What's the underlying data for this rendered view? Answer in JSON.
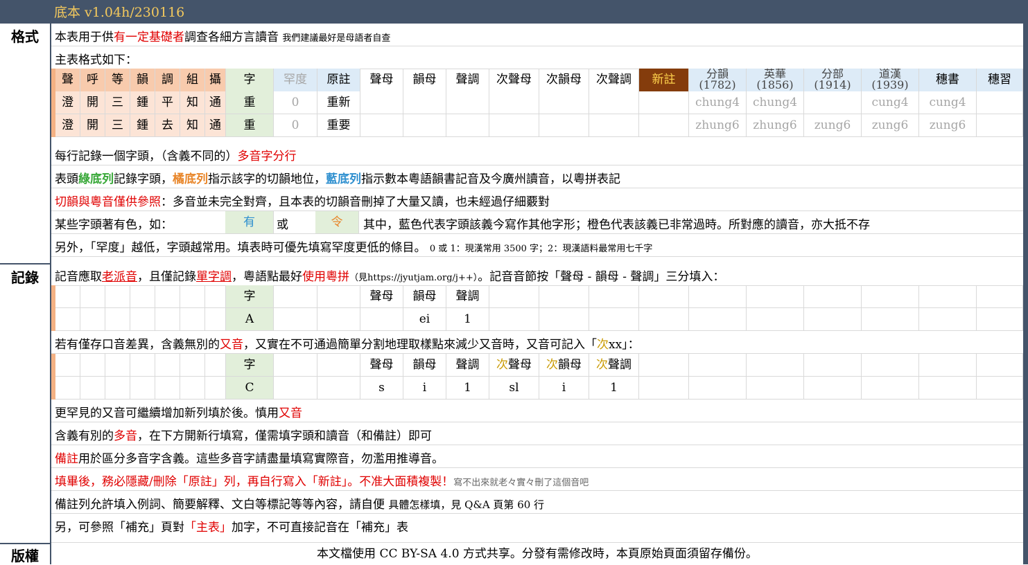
{
  "title": "底本 v1.04h/230116",
  "side_labels": [
    "格式",
    "記錄",
    "版權"
  ],
  "rows": {
    "r1": {
      "a": "本表用于供",
      "b": "有一定基礎者",
      "c": "調查各細方言讀音",
      "d": "我們建議最好是母語者自查"
    },
    "r2": "主表格式如下：",
    "r6": {
      "a": "每行記錄一個字頭，（含義不同的）",
      "b": "多音字分行"
    },
    "r7": {
      "a": "表頭",
      "b": "綠底列",
      "c": "記錄字頭，",
      "d": "橘底列",
      "e": "指示該字的切韻地位，",
      "f": "藍底列",
      "g": "指示數本粵語韻書記音及今廣州讀音，以粵拼表記"
    },
    "r8": {
      "a": "切韻與粵音僅供參照",
      "b": "：多音並未完全對齊，且本表的切韻音刪掉了大量又讀，也未經過仔細覈對"
    },
    "r9": {
      "a": "某些字頭著有色，如：",
      "b": "有",
      "c": "或",
      "d": "令",
      "e": "其中，藍色代表字頭該義今寫作其他字形；橙色代表該義已非常過時。所對應的讀音，亦大抵不存"
    },
    "r10": {
      "a": "另外，「罕度」越低，字頭越常用。填表時可優先填寫罕度更低的條目。",
      "b": "0 或 1：現漢常用 3500 字；2：現漢語料最常用七千字"
    },
    "r11": {
      "a": "記音應取",
      "b": "老派音",
      "c": "，且僅記錄",
      "d": "單字調",
      "e": "，粵語點最好",
      "f": "使用粵拼",
      "g": "（見https://jyutjam.org/j++）",
      "h": "。記音音節按「聲母 - 韻母 - 聲調」三分填入："
    },
    "r14": {
      "a": "若有僅存口音差異，含義無別的",
      "b": "又音",
      "c": "，又實在不可通過簡單分割地理取樣點來減少又音時，又音可記入「",
      "d": "次",
      "e": "xx」："
    },
    "r17": {
      "a": "更罕見的又音可繼續增加新列填於後。慎用",
      "b": "又音"
    },
    "r18": {
      "a": "含義有別的",
      "b": "多音",
      "c": "，在下方開新行填寫，僅需填字頭和讀音（和備註）即可"
    },
    "r19": {
      "a": "備註",
      "b": "用於區分多音字含義。這些多音字請盡量填寫實際音，勿濫用推導音。"
    },
    "r20": {
      "a": "填畢後，務必隱藏/刪除「原註」列，再自行寫入「新註」。不准大面積複製！",
      "b": "寫不出來就老々實々刪了這個音吧"
    },
    "r21": {
      "a": "備註列允許填入例詞、簡要解釋、文白等標記等等內容，請自便",
      "b": "具體怎樣填，見 Q&A 頁第 60 行"
    },
    "r22": {
      "a": "另，可參照「補充」頁對",
      "b": "「主表」",
      "c": "加字，不可直接記音在「補充」表"
    }
  },
  "main_table": {
    "headers": [
      "聲",
      "呼",
      "等",
      "韻",
      "調",
      "組",
      "攝",
      "字",
      "罕度",
      "原註",
      "聲母",
      "韻母",
      "聲調",
      "次聲母",
      "次韻母",
      "次聲調",
      "新註",
      "分韻\n(1782)",
      "英華\n(1856)",
      "分部\n(1914)",
      "道漢\n(1939)",
      "穗書",
      "穗習"
    ],
    "rows": [
      [
        "澄",
        "開",
        "三",
        "鍾",
        "平",
        "知",
        "通",
        "重",
        "0",
        "重新",
        "",
        "",
        "",
        "",
        "",
        "",
        "",
        "chung4",
        "chung4",
        "",
        "cung4",
        "cung4",
        ""
      ],
      [
        "澄",
        "開",
        "三",
        "鍾",
        "去",
        "知",
        "通",
        "重",
        "0",
        "重要",
        "",
        "",
        "",
        "",
        "",
        "",
        "",
        "zhung6",
        "zhung6",
        "zung6",
        "zung6",
        "zung6",
        ""
      ]
    ]
  },
  "example1": {
    "h_char": "字",
    "h_ini": "聲母",
    "h_fin": "韻母",
    "h_tone": "聲調",
    "char": "A",
    "ini": "",
    "fin": "ei",
    "tone": "1"
  },
  "example2": {
    "h_char": "字",
    "h_ini": "聲母",
    "h_fin": "韻母",
    "h_tone": "聲調",
    "h_ci": "次",
    "h_ini2": "聲母",
    "h_fin2": "韻母",
    "h_tone2": "聲調",
    "char": "C",
    "ini": "s",
    "fin": "i",
    "tone": "1",
    "ini2": "sl",
    "fin2": "i",
    "tone2": "1"
  },
  "footer": "本文檔使用 CC BY-SA 4.0 方式共享。分發有需修改時，本頁原始頁面須留存備份。",
  "colors": {
    "header_bar": "#44546a",
    "title": "#f4c95d",
    "orange": "#f8cbad",
    "green": "#e2efda",
    "blue": "#ddebf7",
    "new_note": "#843c0c"
  }
}
